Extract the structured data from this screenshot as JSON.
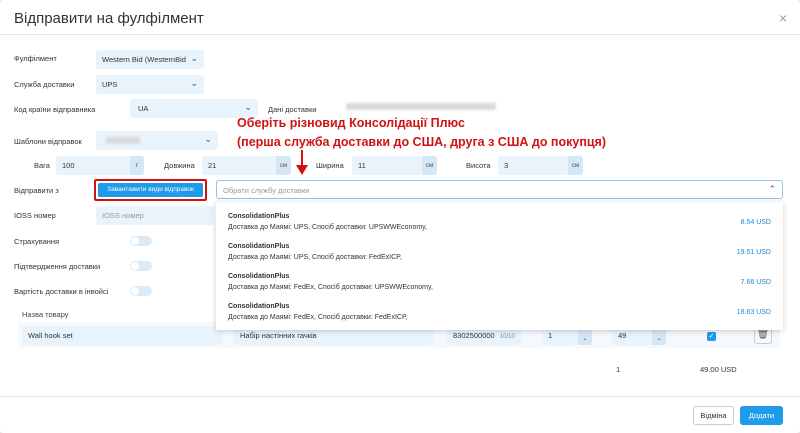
{
  "modal": {
    "title": "Відправити на фулфілмент",
    "close_icon": "×"
  },
  "form": {
    "fulfillment": {
      "label": "Фулфілмент",
      "value": "Western Bid (WesternBid"
    },
    "shipping_service": {
      "label": "Служба доставки",
      "value": "UPS"
    },
    "country_code": {
      "label": "Код країни відправника",
      "value": "UA"
    },
    "shipping_data": {
      "label": "Дані доставки"
    },
    "templates": {
      "label": "Шаблони відправок"
    },
    "weight": {
      "label": "Вага",
      "value": "100",
      "unit": "г"
    },
    "length": {
      "label": "Довжина",
      "value": "21",
      "unit": "см"
    },
    "width": {
      "label": "Ширина",
      "value": "11",
      "unit": "см"
    },
    "height": {
      "label": "Висота",
      "value": "3",
      "unit": "см"
    },
    "ship_from": {
      "label": "Відправити з",
      "load_button": "Завантажити види відправок",
      "placeholder": "Обрати службу доставки"
    },
    "ioss": {
      "label": "IOSS номер",
      "placeholder": "IOSS номер"
    },
    "insurance": {
      "label": "Страхування"
    },
    "delivery_confirmation": {
      "label": "Підтвердження доставки"
    },
    "invoice_shipping_cost": {
      "label": "Вартість доставки в інвойсі"
    }
  },
  "annotation": {
    "line1": "Оберіть різновид Консолідації Плюс",
    "line2": "(перша служба доставки до США, друга з США до покупця)"
  },
  "dropdown_options": [
    {
      "name": "ConsolidationPlus",
      "desc": "Доставка до Маямі: UPS, Спосіб доставки: UPSWWEconomy,",
      "price": "8.54 USD"
    },
    {
      "name": "ConsolidationPlus",
      "desc": "Доставка до Маямі: UPS, Спосіб доставки: FedExICP,",
      "price": "19.51 USD"
    },
    {
      "name": "ConsolidationPlus",
      "desc": "Доставка до Маямі: FedEx, Спосіб доставки: UPSWWEconomy,",
      "price": "7.66 USD"
    },
    {
      "name": "ConsolidationPlus",
      "desc": "Доставка до Маямі: FedEx, Спосіб доставки: FedExICP,",
      "price": "18.63 USD"
    }
  ],
  "table": {
    "header_name": "Назва товару",
    "row": {
      "name": "Wall hook set",
      "description": "Набір настінних гачків",
      "code": "8302500000",
      "code_count": "10/10",
      "qty": "1",
      "price": "49"
    },
    "totals": {
      "qty": "1",
      "amount": "49.00 USD"
    }
  },
  "footer": {
    "cancel": "Відміна",
    "add": "Додати"
  },
  "colors": {
    "accent": "#1e9be9",
    "annotation": "#d01212"
  }
}
